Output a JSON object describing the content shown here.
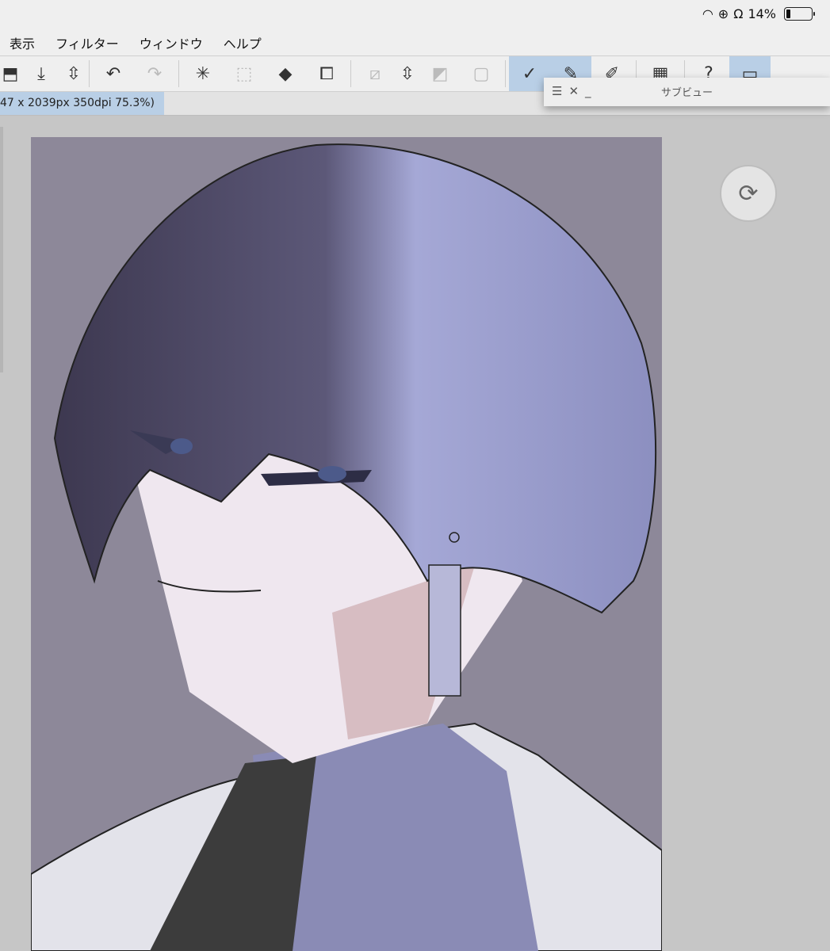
{
  "status_bar": {
    "battery_percent": "14%",
    "battery_level": 0.14
  },
  "menu": [
    "表示",
    "フィルター",
    "ウィンドウ",
    "ヘルプ"
  ],
  "toolbar": {
    "icons": [
      "share-icon",
      "save-icon",
      "updown-icon",
      "undo-icon",
      "redo-icon",
      "clear-selection-icon",
      "select-icon",
      "fill-icon",
      "transform-icon",
      "deselect-icon",
      "updown2-icon",
      "invert-icon",
      "border-icon",
      "pen1-icon",
      "pen2-icon",
      "pen3-icon",
      "grid-icon",
      "help-icon",
      "window-icon"
    ]
  },
  "document_tab": {
    "label": "47 x 2039px 350dpi 75.3%)"
  },
  "subview": {
    "title": "サブビュー",
    "menu": "☰",
    "close": "✕",
    "minimize": "_"
  },
  "colors": {
    "toolbar_active": "#b9cfe6",
    "canvas_bg": "#8d8899"
  }
}
